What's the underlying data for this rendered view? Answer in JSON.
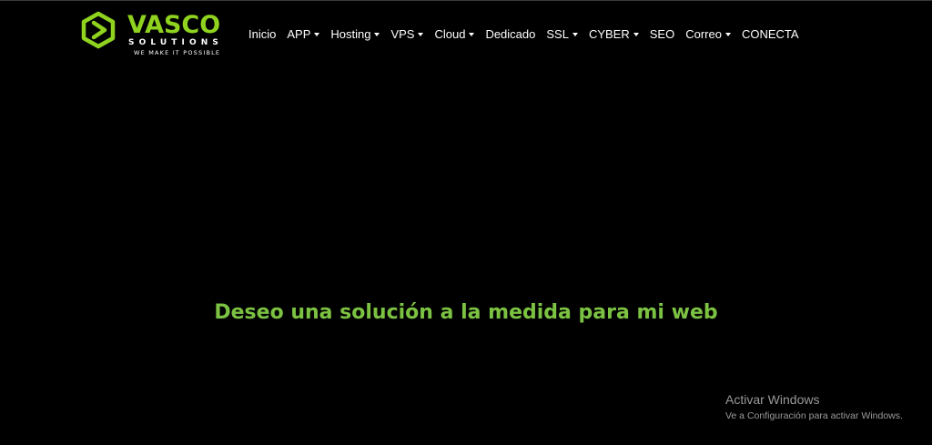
{
  "brand": {
    "name": "VASCO",
    "sub": "SOLUTIONS",
    "tagline": "WE MAKE IT POSSIBLE",
    "accent_color": "#8fd31f"
  },
  "nav": {
    "items": [
      {
        "label": "Inicio",
        "dropdown": false
      },
      {
        "label": "APP",
        "dropdown": true
      },
      {
        "label": "Hosting",
        "dropdown": true
      },
      {
        "label": "VPS",
        "dropdown": true
      },
      {
        "label": "Cloud",
        "dropdown": true
      },
      {
        "label": "Dedicado",
        "dropdown": false
      },
      {
        "label": "SSL",
        "dropdown": true
      },
      {
        "label": "CYBER",
        "dropdown": true
      },
      {
        "label": "SEO",
        "dropdown": false
      },
      {
        "label": "Correo",
        "dropdown": true
      },
      {
        "label": "CONECTA",
        "dropdown": false
      }
    ]
  },
  "hero": {
    "title": "Deseo una solución a la medida para mi web",
    "color": "#7cc242"
  },
  "watermark": {
    "title": "Activar Windows",
    "subtitle": "Ve a Configuración para activar Windows."
  },
  "icons": {
    "logo": "hexagon-play-icon",
    "dropdown": "caret-down-icon"
  }
}
